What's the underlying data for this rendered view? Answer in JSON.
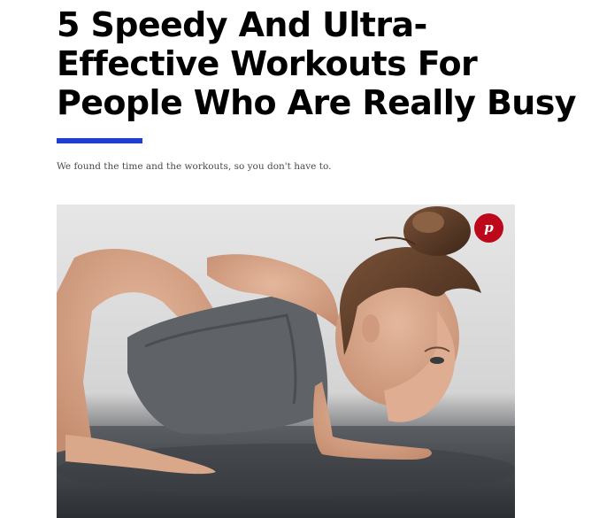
{
  "article": {
    "headline": "5 Speedy And Ultra-Effective Workouts For People Who Are Really Busy",
    "dek": "We found the time and the workouts, so you don't have to."
  },
  "colors": {
    "accent_rule": "#1f3fd0",
    "pinterest": "#bd081c"
  },
  "hero": {
    "pin_button_icon": "pinterest-icon"
  }
}
